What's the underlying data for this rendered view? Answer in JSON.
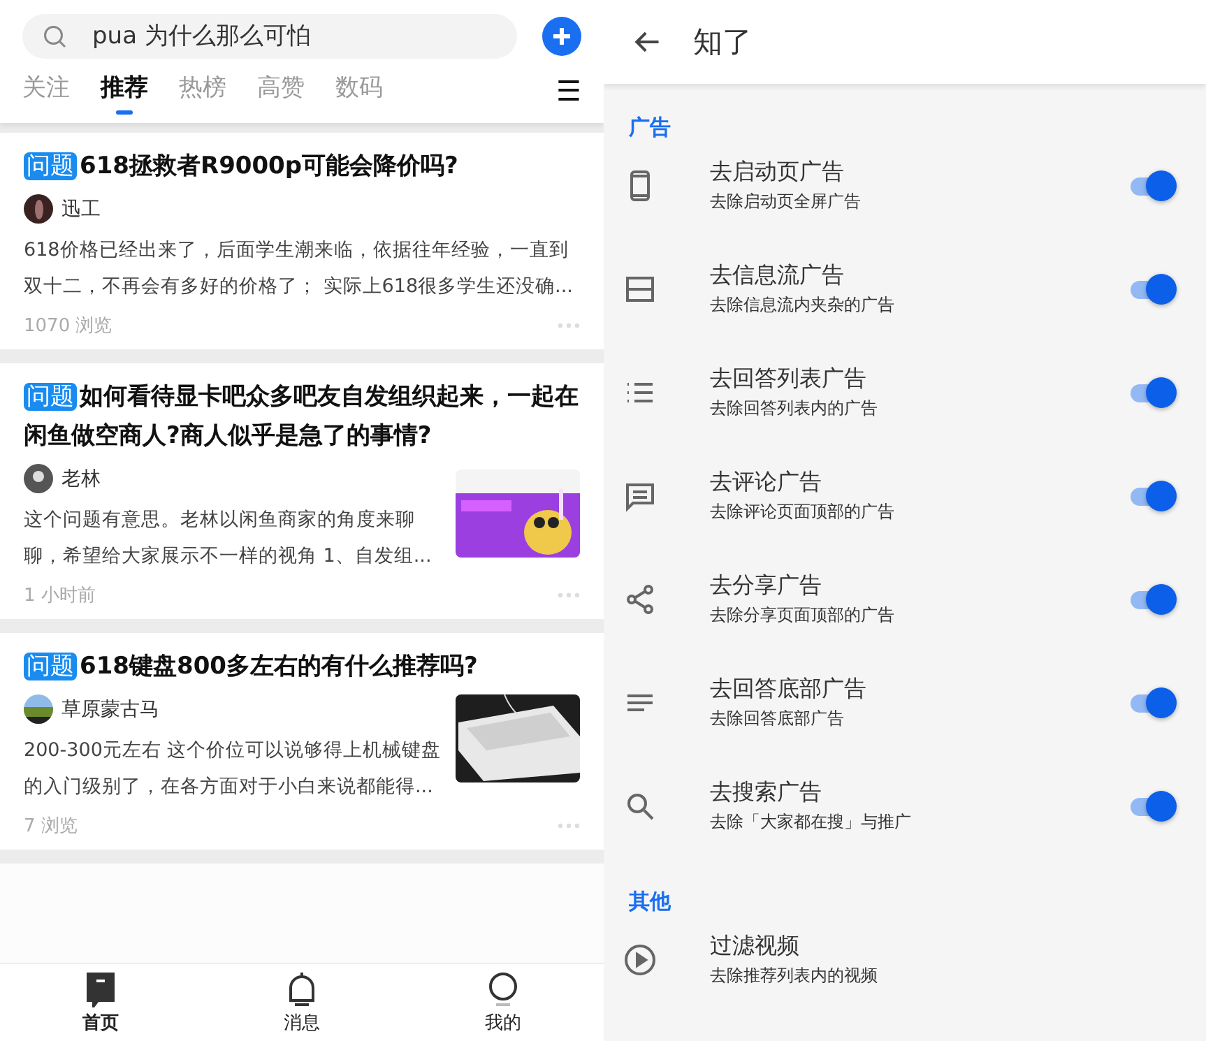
{
  "feed": {
    "search": {
      "placeholder": "pua 为什么那么可怕"
    },
    "tabs": [
      {
        "label": "关注",
        "selected": false
      },
      {
        "label": "推荐",
        "selected": true
      },
      {
        "label": "热榜",
        "selected": false
      },
      {
        "label": "高赞",
        "selected": false
      },
      {
        "label": "数码",
        "selected": false
      }
    ],
    "menu_glyph": "☰",
    "cards": [
      {
        "tag": "问题",
        "title": "618拯救者R9000p可能会降价吗?",
        "author": "迅工",
        "excerpt": "618价格已经出来了，后面学生潮来临，依据往年经验，一直到双十二，不再会有多好的价格了； 实际上618很多学生还没确...",
        "meta": "1070 浏览",
        "thumbnail": false
      },
      {
        "tag": "问题",
        "title": "如何看待显卡吧众多吧友自发组织起来，一起在闲鱼做空商人?商人似乎是急了的事情?",
        "author": "老林",
        "excerpt": "这个问题有意思。老林以闲鱼商家的角度来聊聊，希望给大家展示不一样的视角 1、自发组...",
        "meta": "1 小时前",
        "thumbnail": true
      },
      {
        "tag": "问题",
        "title": "618键盘800多左右的有什么推荐吗?",
        "author": "草原蒙古马",
        "excerpt": "200-300元左右 这个价位可以说够得上机械键盘的入门级别了，在各方面对于小白来说都能得...",
        "meta": "7 浏览",
        "thumbnail": true
      }
    ],
    "nav": [
      {
        "label": "首页",
        "selected": true
      },
      {
        "label": "消息",
        "selected": false
      },
      {
        "label": "我的",
        "selected": false
      }
    ]
  },
  "settings": {
    "title": "知了",
    "sections": [
      {
        "title": "广告",
        "items": [
          {
            "kind": "switch",
            "title": "去启动页广告",
            "subtitle": "去除启动页全屏广告",
            "on": true
          },
          {
            "kind": "switch",
            "title": "去信息流广告",
            "subtitle": "去除信息流内夹杂的广告",
            "on": true
          },
          {
            "kind": "switch",
            "title": "去回答列表广告",
            "subtitle": "去除回答列表内的广告",
            "on": true
          },
          {
            "kind": "switch",
            "title": "去评论广告",
            "subtitle": "去除评论页面顶部的广告",
            "on": true
          },
          {
            "kind": "switch",
            "title": "去分享广告",
            "subtitle": "去除分享页面顶部的广告",
            "on": true
          },
          {
            "kind": "switch",
            "title": "去回答底部广告",
            "subtitle": "去除回答底部广告",
            "on": true
          },
          {
            "kind": "switch",
            "title": "去搜索广告",
            "subtitle": "去除「大家都在搜」与推广",
            "on": true
          }
        ]
      },
      {
        "title": "其他",
        "items": [
          {
            "kind": "link",
            "title": "过滤视频",
            "subtitle": "去除推荐列表内的视频"
          }
        ]
      }
    ]
  }
}
